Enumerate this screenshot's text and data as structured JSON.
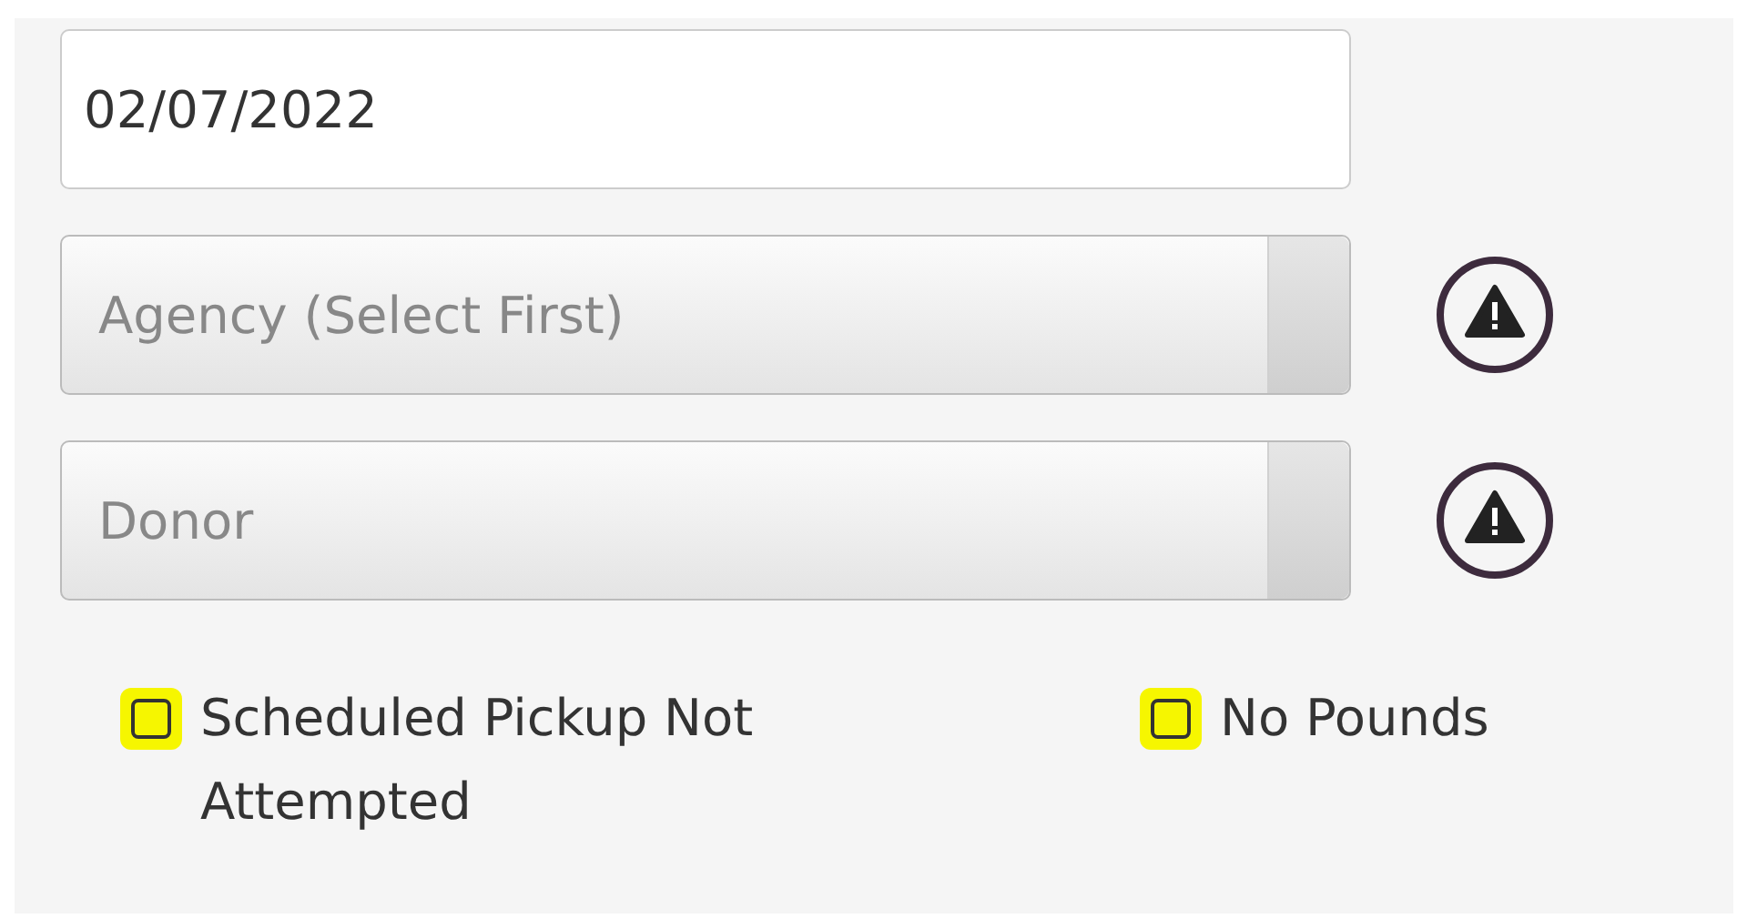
{
  "date_field": {
    "value": "02/07/2022"
  },
  "selects": [
    {
      "placeholder": "Agency (Select First)",
      "warning": true
    },
    {
      "placeholder": "Donor",
      "warning": true
    }
  ],
  "checkboxes": [
    {
      "label": "Scheduled Pickup Not Attempted",
      "checked": false,
      "highlighted": true
    },
    {
      "label": "No Pounds",
      "checked": false,
      "highlighted": true
    }
  ]
}
